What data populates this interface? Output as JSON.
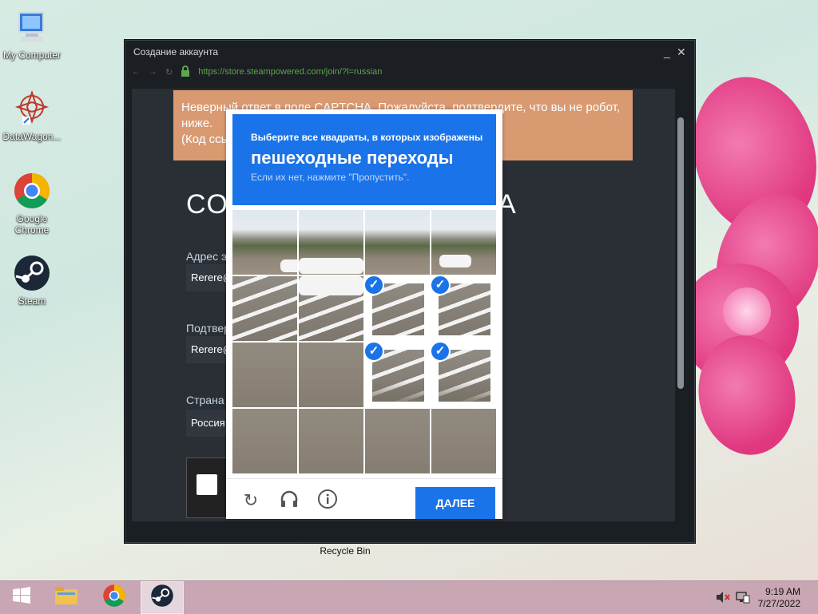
{
  "desktop": {
    "icons": [
      {
        "label": "My Computer",
        "icon": "computer-icon"
      },
      {
        "label": "DataWagon...",
        "icon": "datawagon-icon"
      },
      {
        "label": "Google Chrome",
        "icon": "chrome-icon"
      },
      {
        "label": "Steam",
        "icon": "steam-icon"
      }
    ],
    "recycle_bin": "Recycle Bin"
  },
  "window": {
    "title": "Создание аккаунта",
    "minimize": "_",
    "close": "✕",
    "url": "https://store.steampowered.com/join/?l=russian"
  },
  "page": {
    "error_text": "Неверный ответ в поле CAPTCHA. Пожалуйста, подтвердите, что вы не робот, ниже.",
    "error_text2": "(Код ссы",
    "heading_left": "CO",
    "heading_right": "A",
    "email_label": "Адрес э",
    "email_value": "Rerere@",
    "confirm_label": "Подтвер",
    "confirm_value": "Rerere@",
    "country_label": "Страна",
    "country_value": "Россия"
  },
  "captcha": {
    "instruction": "Выберите все квадраты, в которых изображены",
    "target": "пешеходные переходы",
    "hint": "Если их нет, нажмите \"Пропустить\".",
    "next_label": "ДАЛЕЕ",
    "checkmark": "✓",
    "selected_tiles": [
      6,
      7,
      10,
      11
    ]
  },
  "taskbar": {
    "time": "9:19 AM",
    "date": "7/27/2022",
    "items": [
      "start-icon",
      "file-explorer-icon",
      "chrome-icon",
      "steam-icon"
    ]
  }
}
